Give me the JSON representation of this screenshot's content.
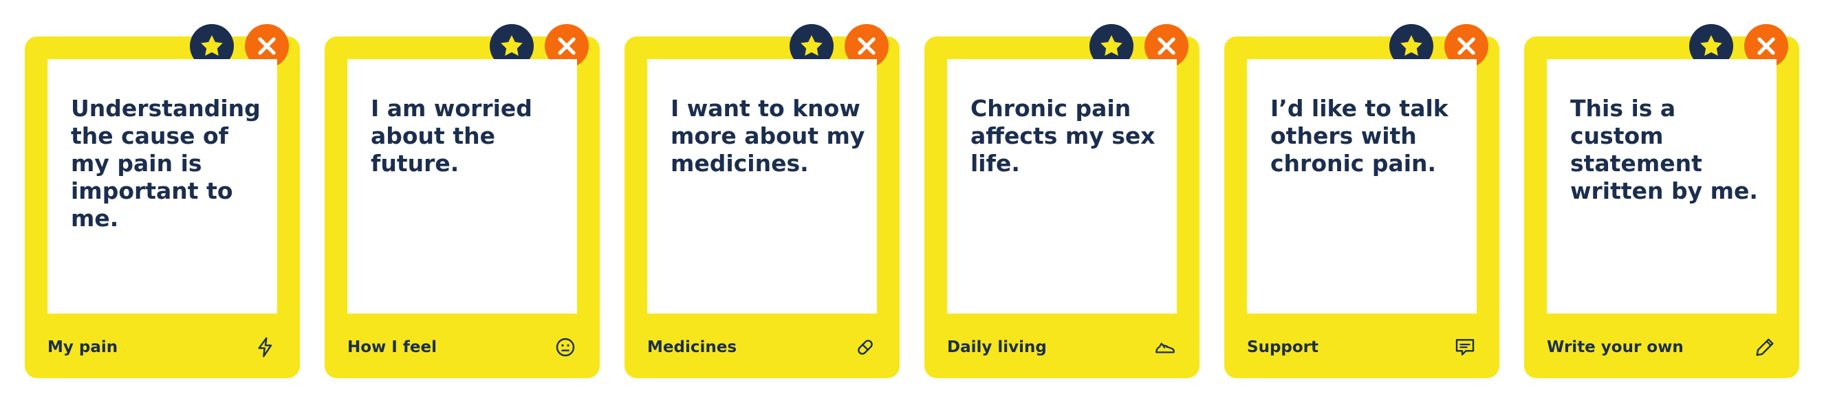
{
  "colors": {
    "card": "#f7e61b",
    "text": "#1b2e4f",
    "favorite_button": "#1b2e4f",
    "remove_button": "#f56a0c",
    "star": "#f7e61b"
  },
  "cards": [
    {
      "statement": "Understanding the cause of my pain is important to me.",
      "category": "My pain",
      "icon": "lightning-icon"
    },
    {
      "statement": "I am worried about the future.",
      "category": "How I feel",
      "icon": "neutral-face-icon"
    },
    {
      "statement": "I want to know more about my medicines.",
      "category": "Medicines",
      "icon": "pill-icon"
    },
    {
      "statement": "Chronic pain affects my sex life.",
      "category": "Daily living",
      "icon": "shoe-icon"
    },
    {
      "statement": "I’d like to talk others with chronic pain.",
      "category": "Support",
      "icon": "speech-bubble-icon"
    },
    {
      "statement": "This is a custom statement written by me.",
      "category": "Write your own",
      "icon": "pencil-icon"
    }
  ]
}
